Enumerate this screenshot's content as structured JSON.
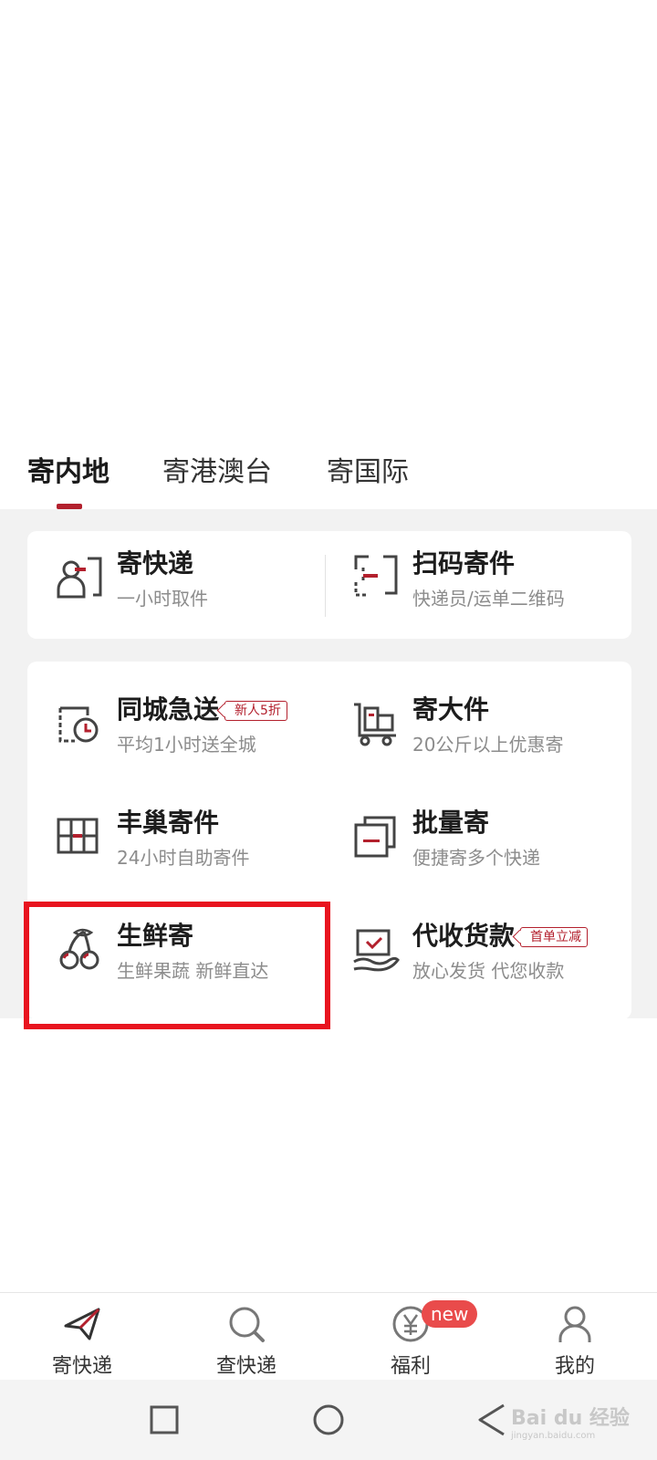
{
  "tabs": {
    "items": [
      {
        "label": "寄内地"
      },
      {
        "label": "寄港澳台"
      },
      {
        "label": "寄国际"
      }
    ]
  },
  "top_card": {
    "items": [
      {
        "title": "寄快递",
        "subtitle": "一小时取件",
        "icon": "person-frame-icon"
      },
      {
        "title": "扫码寄件",
        "subtitle": "快递员/运单二维码",
        "icon": "scan-frame-icon"
      }
    ]
  },
  "grid": {
    "items": [
      {
        "title": "同城急送",
        "subtitle": "平均1小时送全城",
        "tag": "新人5折",
        "icon": "box-clock-icon"
      },
      {
        "title": "寄大件",
        "subtitle": "20公斤以上优惠寄",
        "icon": "trolley-icon"
      },
      {
        "title": "丰巢寄件",
        "subtitle": "24小时自助寄件",
        "icon": "locker-icon"
      },
      {
        "title": "批量寄",
        "subtitle": "便捷寄多个快递",
        "icon": "stack-icon"
      },
      {
        "title": "生鲜寄",
        "subtitle": "生鲜果蔬 新鲜直达",
        "icon": "cherry-icon"
      },
      {
        "title": "代收货款",
        "subtitle": "放心发货 代您收款",
        "tag": "首单立减",
        "icon": "hand-check-icon"
      }
    ]
  },
  "bottom_nav": {
    "items": [
      {
        "label": "寄快递",
        "icon": "paper-plane-icon"
      },
      {
        "label": "查快递",
        "icon": "search-icon"
      },
      {
        "label": "福利",
        "icon": "yen-coin-icon",
        "badge": "new"
      },
      {
        "label": "我的",
        "icon": "user-icon"
      }
    ]
  },
  "watermark": {
    "text": "Bai du 经验",
    "sub": "jingyan.baidu.com"
  },
  "colors": {
    "accent": "#b3202d",
    "highlight": "#e8141f",
    "badge": "#e94b4b"
  }
}
